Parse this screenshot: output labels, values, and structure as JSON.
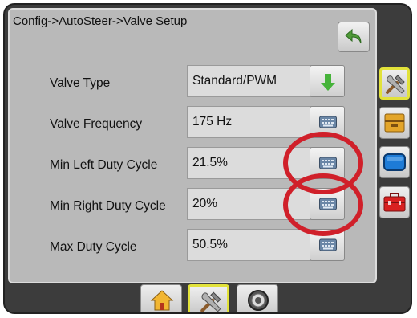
{
  "header": {
    "breadcrumb": "Config->AutoSteer->Valve Setup"
  },
  "settings": [
    {
      "label": "Valve Type",
      "value": "Standard/PWM",
      "action_icon": "down-arrow-icon"
    },
    {
      "label": "Valve Frequency",
      "value": "175 Hz",
      "action_icon": "keyboard-icon"
    },
    {
      "label": "Min Left Duty Cycle",
      "value": "21.5%",
      "action_icon": "keyboard-icon"
    },
    {
      "label": "Min Right Duty Cycle",
      "value": "20%",
      "action_icon": "keyboard-icon"
    },
    {
      "label": "Max Duty Cycle",
      "value": "50.5%",
      "action_icon": "keyboard-icon"
    }
  ],
  "sidebar": {
    "items": [
      {
        "icon": "tools-icon",
        "active": true
      },
      {
        "icon": "file-cabinet-icon",
        "active": false
      },
      {
        "icon": "monitor-screen-icon",
        "active": false
      },
      {
        "icon": "toolbox-icon",
        "active": false
      }
    ]
  },
  "bottom_nav": {
    "items": [
      {
        "icon": "home-icon",
        "active": false
      },
      {
        "icon": "tools-icon",
        "active": true
      },
      {
        "icon": "gauge-icon",
        "active": false
      }
    ]
  },
  "colors": {
    "highlight_circle": "#d0202a",
    "active_border": "#e2e23a",
    "arrow_green": "#46b33a",
    "back_arrow_green": "#4f9a38"
  }
}
